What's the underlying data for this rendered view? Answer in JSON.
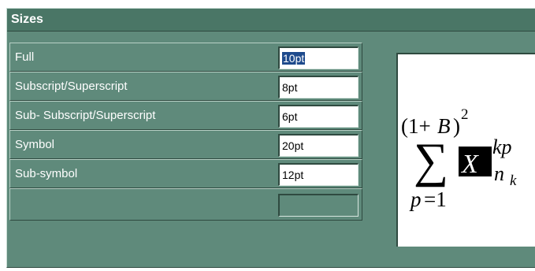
{
  "panel": {
    "title": "Sizes"
  },
  "rows": [
    {
      "label": "Full",
      "value": "10pt",
      "selected": true
    },
    {
      "label": "Subscript/Superscript",
      "value": "8pt"
    },
    {
      "label": "Sub- Subscript/Superscript",
      "value": "6pt"
    },
    {
      "label": "Symbol",
      "value": "20pt"
    },
    {
      "label": "Sub-symbol",
      "value": "12pt"
    },
    {
      "label": "",
      "value": ""
    }
  ],
  "preview": {
    "open_paren": "(1+",
    "var_b": "B",
    "close_paren": ")",
    "exp_2": "2",
    "sum": "∑",
    "var_x": "X",
    "sup_kp": "kp",
    "sub_n": "n",
    "sub_k": "k",
    "lower": "p",
    "lower_eq": "=1"
  }
}
